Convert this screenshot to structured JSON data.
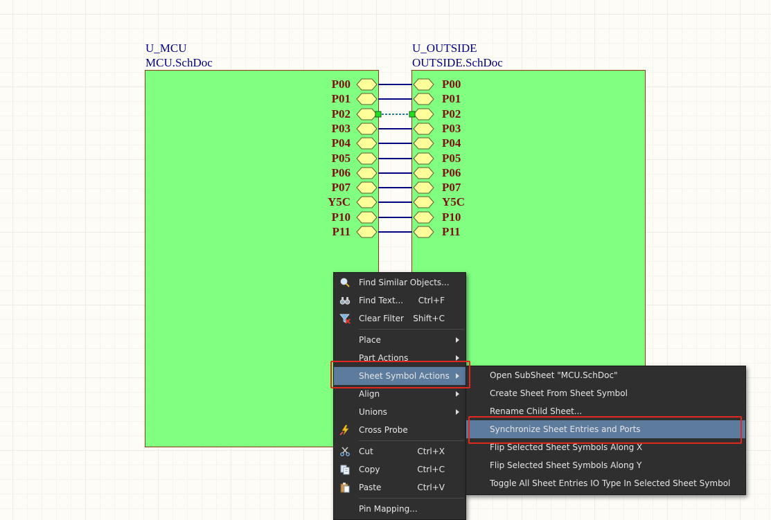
{
  "sheets": {
    "left": {
      "designator": "U_MCU",
      "filename": "MCU.SchDoc"
    },
    "right": {
      "designator": "U_OUTSIDE",
      "filename": "OUTSIDE.SchDoc"
    }
  },
  "entries": [
    "P00",
    "P01",
    "P02",
    "P03",
    "P04",
    "P05",
    "P06",
    "P07",
    "Y5C",
    "P10",
    "P11"
  ],
  "colors": {
    "sheet_fill": "#80ff80",
    "sheet_border": "#8b3a14",
    "entry_fill": "#ffff99",
    "entry_text": "#7a1010",
    "wire": "#000080",
    "menu_bg": "#2f2f2f",
    "menu_selected": "#5d7b9d",
    "annotation": "#e0281e"
  },
  "context_menu": {
    "items": [
      {
        "label": "Find Similar Objects...",
        "shortcut": "",
        "icon": "magnifier-icon",
        "submenu": false
      },
      {
        "label": "Find Text...",
        "shortcut": "Ctrl+F",
        "icon": "binoculars-icon",
        "submenu": false
      },
      {
        "label": "Clear Filter",
        "shortcut": "Shift+C",
        "icon": "clear-filter-icon",
        "submenu": false
      },
      {
        "label": "Place",
        "shortcut": "",
        "icon": "",
        "submenu": true
      },
      {
        "label": "Part Actions",
        "shortcut": "",
        "icon": "",
        "submenu": true
      },
      {
        "label": "Sheet Symbol Actions",
        "shortcut": "",
        "icon": "",
        "submenu": true,
        "selected": true
      },
      {
        "label": "Align",
        "shortcut": "",
        "icon": "",
        "submenu": true
      },
      {
        "label": "Unions",
        "shortcut": "",
        "icon": "",
        "submenu": true
      },
      {
        "label": "Cross Probe",
        "shortcut": "",
        "icon": "cross-probe-icon",
        "submenu": false
      },
      {
        "label": "Cut",
        "shortcut": "Ctrl+X",
        "icon": "scissors-icon",
        "submenu": false
      },
      {
        "label": "Copy",
        "shortcut": "Ctrl+C",
        "icon": "copy-icon",
        "submenu": false
      },
      {
        "label": "Paste",
        "shortcut": "Ctrl+V",
        "icon": "paste-icon",
        "submenu": false
      },
      {
        "label": "Pin Mapping...",
        "shortcut": "",
        "icon": "",
        "submenu": false
      }
    ]
  },
  "submenu": {
    "items": [
      {
        "label": "Open SubSheet \"MCU.SchDoc\""
      },
      {
        "label": "Create Sheet From Sheet Symbol"
      },
      {
        "label": "Rename Child Sheet..."
      },
      {
        "label": "Synchronize Sheet Entries and Ports",
        "selected": true
      },
      {
        "label": "Flip Selected Sheet Symbols Along X"
      },
      {
        "label": "Flip Selected Sheet Symbols Along Y"
      },
      {
        "label": "Toggle All Sheet Entries IO Type In Selected Sheet Symbol"
      }
    ]
  }
}
